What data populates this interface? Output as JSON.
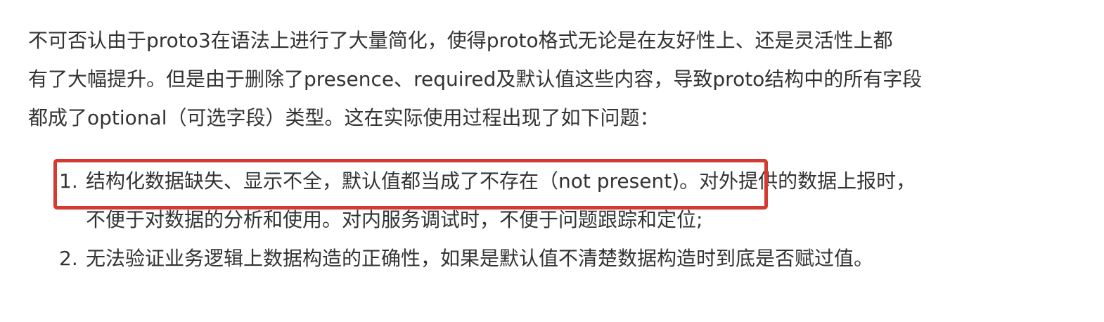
{
  "intro": {
    "lines": [
      "不可否认由于proto3在语法上进行了大量简化，使得proto格式无论是在友好性上、还是灵活性上都",
      "有了大幅提升。但是由于删除了presence、required及默认值这些内容，导致proto结构中的所有字段",
      "都成了optional（可选字段）类型。这在实际使用过程出现了如下问题："
    ]
  },
  "list": {
    "items": [
      {
        "number": "1.",
        "lines": [
          "结构化数据缺失、显示不全，默认值都当成了不存在（not present)。对外提供的数据上报时，",
          "不便于对数据的分析和使用。对内服务调试时，不便于问题跟踪和定位;"
        ]
      },
      {
        "number": "2.",
        "lines": [
          "无法验证业务逻辑上数据构造的正确性，如果是默认值不清楚数据构造时到底是否赋过值。"
        ]
      }
    ]
  },
  "highlight": {
    "color": "#d43a2f"
  }
}
